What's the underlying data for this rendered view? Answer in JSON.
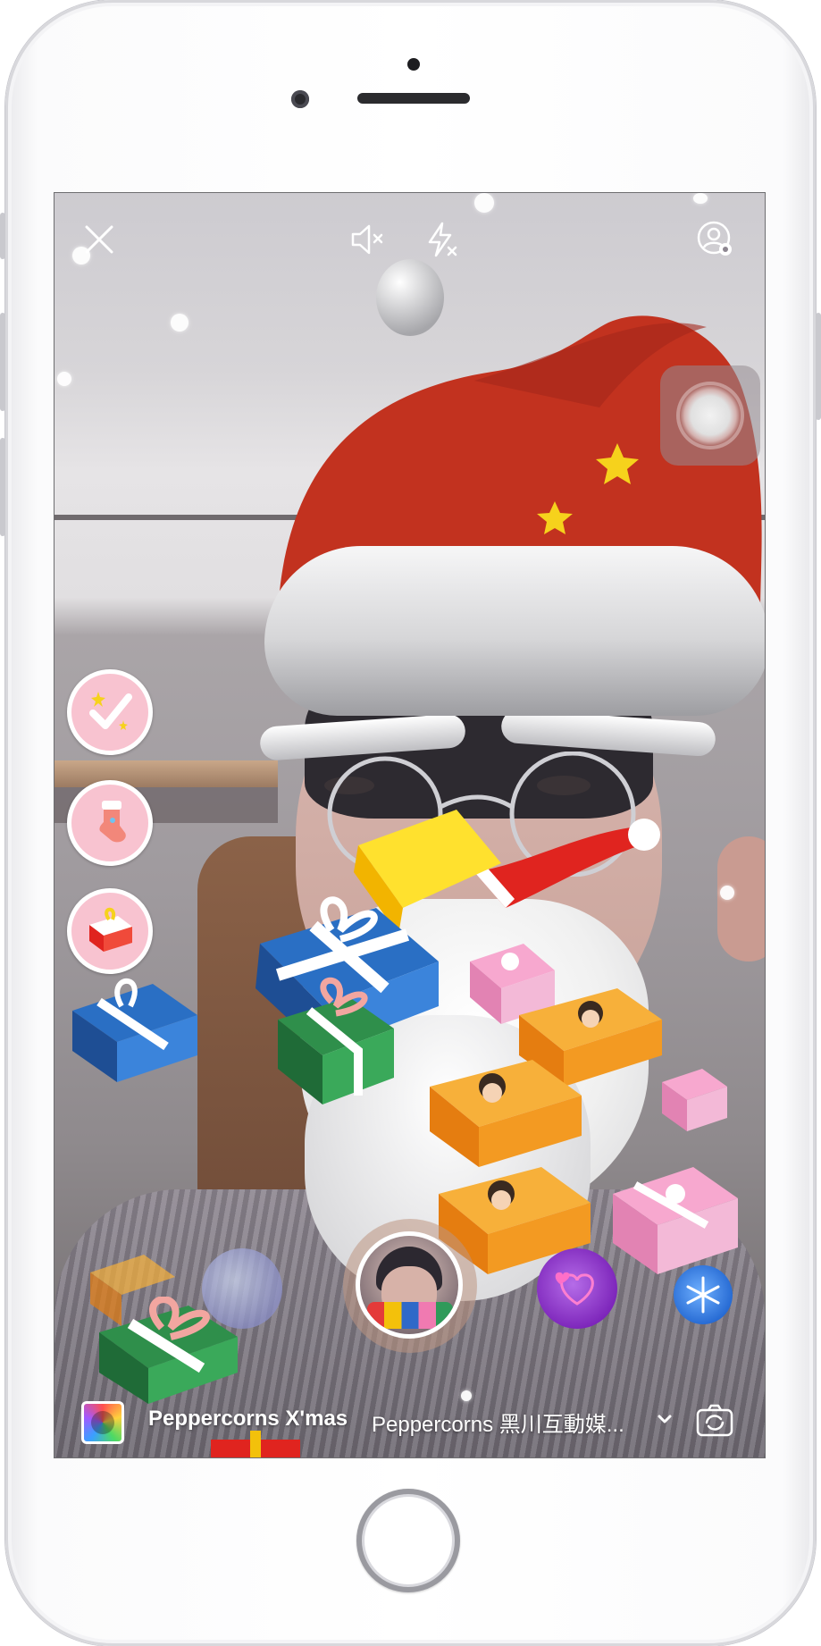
{
  "screen": {
    "close_icon": "close-icon",
    "mute_icon": "sound-off-icon",
    "flash_icon": "flash-off-icon",
    "settings_icon": "user-settings-icon"
  },
  "effects_tray": [
    {
      "name": "sparkle-check-effect",
      "icon": "sparkle-check-icon"
    },
    {
      "name": "christmas-stocking-effect",
      "icon": "stocking-icon"
    },
    {
      "name": "gift-box-effect",
      "icon": "gift-icon"
    }
  ],
  "bottom": {
    "effect_title": "Peppercorns X'mas",
    "effect_author": "Peppercorns 黑川互動媒..."
  },
  "colors": {
    "hat_red": "#c2321f",
    "star_yellow": "#f6d21c",
    "effect_button_pink": "#f8c3d0",
    "gift_blue": "#2a6fc4",
    "gift_green": "#2f8f4b",
    "gift_pink": "#f08fbf",
    "gift_orange": "#f39a22"
  }
}
